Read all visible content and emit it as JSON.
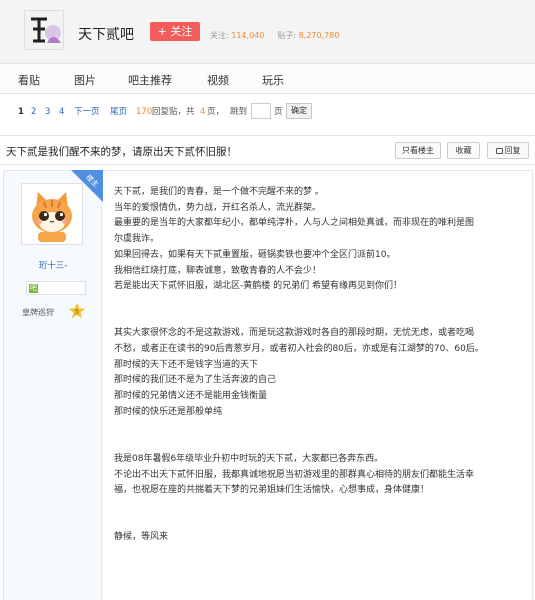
{
  "forum": {
    "name": "天下贰吧",
    "follow_label": "+ 关注",
    "followers_label": "关注:",
    "followers": "114,040",
    "posts_label": "贴子:",
    "posts": "8,270,780"
  },
  "nav": {
    "items": [
      {
        "label": "看贴"
      },
      {
        "label": "图片"
      },
      {
        "label": "吧主推荐"
      },
      {
        "label": "视频"
      },
      {
        "label": "玩乐"
      }
    ]
  },
  "pager": {
    "current": "1",
    "pages": [
      "2",
      "3",
      "4"
    ],
    "next": "下一页",
    "last": "尾页",
    "reply_count": "170",
    "reply_label": "回复贴，共",
    "page_count": "4",
    "page_label": "页，",
    "jump_label": "跳到",
    "page_unit": "页",
    "confirm": "确定"
  },
  "thread": {
    "title": "天下贰是我们醒不来的梦，请原出天下贰怀旧服！",
    "only_op": "只看楼主",
    "favorite": "收藏",
    "reply": "回复"
  },
  "author": {
    "username": "珩十三-",
    "badge": "皇牌巡狩",
    "badge_level": "5",
    "level_icon": "吧",
    "corner_label": "楼主"
  },
  "post": {
    "lines": [
      "天下贰，是我们的青春，是一个做不完醒不来的梦 。",
      "当年的爱恨情仇，势力战，开红名杀人，流光群架。",
      "最重要的是当年的大家都年纪小，都单纯淳朴，人与人之间相处真诚，而非现在的唯利是图",
      "尔虞我诈。",
      "如果回得去，如果有天下贰重置版，砸锅卖铁也要冲个全区门派前10。",
      "我相信红烧打底，聊表诚意，致敬青春的人不会少！",
      "若是能出天下贰怀旧服，湖北区-黄鹤楼 的兄弟们 希望有缘再见到你们！",
      "",
      "",
      "其实大家很怀念的不是这款游戏，而是玩这款游戏时各自的那段时期，无忧无虑，或者吃喝",
      "不愁，或者正在读书的90后青葱岁月，或者初入社会的80后，亦或是有江湖梦的70、60后。",
      "那时候的天下还不是钱字当道的天下",
      "那时候的我们还不是为了生活奔波的自己",
      "那时候的兄弟情义还不是能用金钱衡量",
      "那时候的快乐还是那般单纯",
      "",
      "",
      "我是08年暑假6年级毕业升初中时玩的天下贰，大家都已各奔东西。",
      "不论出不出天下贰怀旧服，我都真诚地祝愿当初游戏里的那群真心相待的朋友们都能生活幸",
      "福，也祝愿在座的共揣着天下梦的兄弟姐妹们生活愉快，心想事成，身体健康！",
      "",
      "",
      "静候，等风来"
    ]
  },
  "colors": {
    "follow_button": "#f45b5b",
    "stat_number": "#f08a2e",
    "link": "#2d64b3"
  }
}
